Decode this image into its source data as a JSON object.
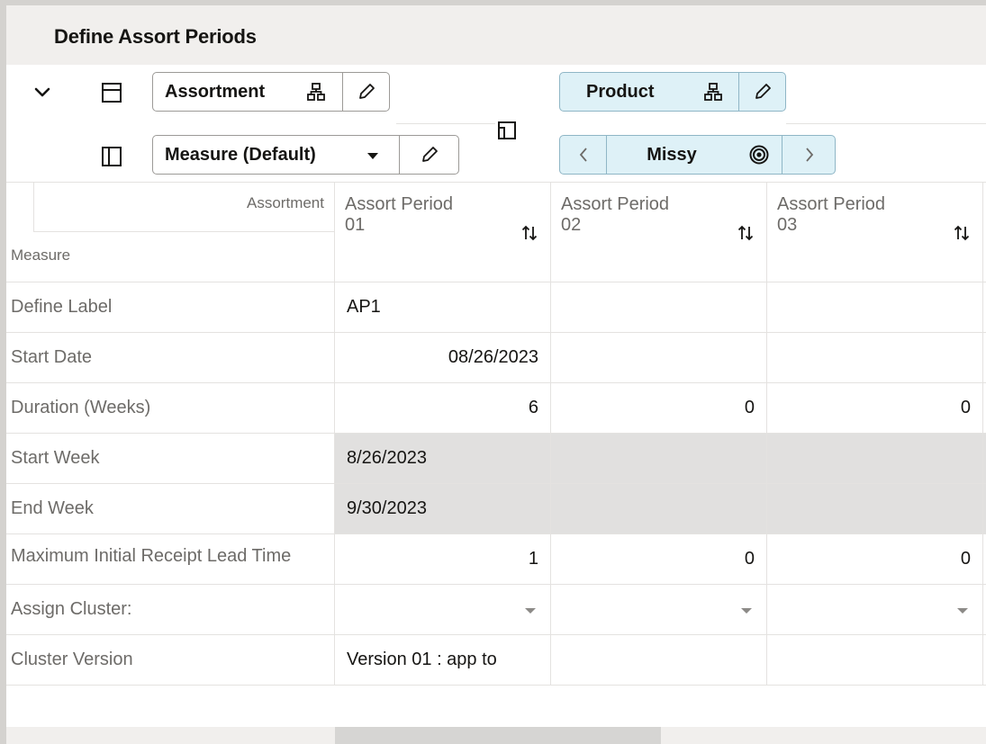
{
  "title": "Define Assort Periods",
  "toolbar": {
    "row_tile": {
      "label": "Assortment"
    },
    "col_tile": {
      "label": "Measure (Default)"
    },
    "page_tile": {
      "label": "Product",
      "current": "Missy"
    }
  },
  "grid": {
    "corner_col_label": "Assortment",
    "corner_row_label": "Measure",
    "columns": [
      {
        "line1": "Assort Period",
        "line2": "01"
      },
      {
        "line1": "Assort Period",
        "line2": "02"
      },
      {
        "line1": "Assort Period",
        "line2": "03"
      }
    ],
    "rows": [
      {
        "label": "Define Label",
        "cells": [
          "AP1",
          "",
          ""
        ]
      },
      {
        "label": "Start Date",
        "cells": [
          "08/26/2023",
          "",
          ""
        ]
      },
      {
        "label": "Duration (Weeks)",
        "cells": [
          "6",
          "0",
          "0"
        ]
      },
      {
        "label": "Start Week",
        "cells": [
          "8/26/2023",
          "",
          ""
        ]
      },
      {
        "label": "End Week",
        "cells": [
          "9/30/2023",
          "",
          ""
        ]
      },
      {
        "label": "Maximum Initial Receipt Lead Time",
        "cells": [
          "1",
          "0",
          "0"
        ]
      },
      {
        "label": "Assign Cluster:",
        "cells": [
          "",
          "",
          ""
        ]
      },
      {
        "label": "Cluster Version",
        "cells": [
          "Version 01 : app to",
          "",
          ""
        ]
      }
    ]
  },
  "colors": {
    "title_bar_bg": "#f1efed",
    "chip_blue_bg": "#def1f7",
    "readonly_cell_bg": "#e1e0df"
  }
}
